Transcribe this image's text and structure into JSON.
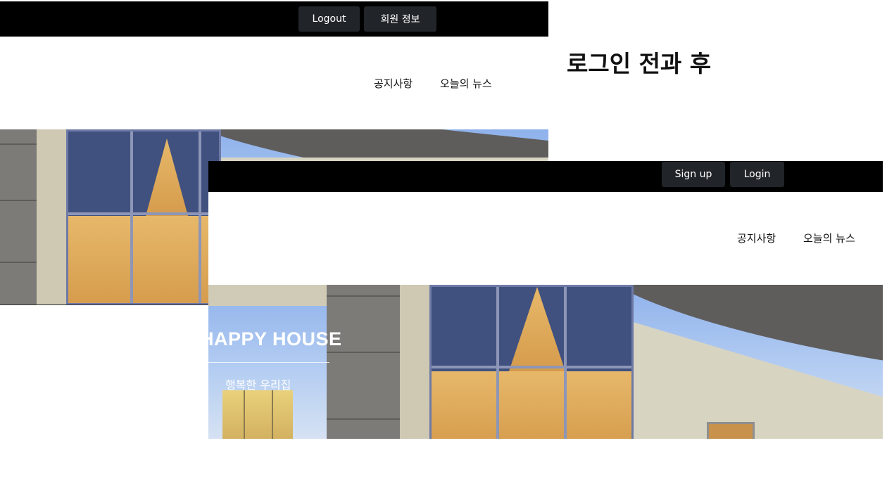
{
  "caption": "로그인 전과 후",
  "after_login": {
    "topbar": {
      "logout_label": "Logout",
      "member_info_label": "회원 정보"
    },
    "nav": {
      "notice_label": "공지사항",
      "news_label": "오늘의 뉴스"
    },
    "hero": {
      "title": "HAPPY HOUSE",
      "subtitle": "행복한 우리집"
    }
  },
  "before_login": {
    "topbar": {
      "signup_label": "Sign up",
      "login_label": "Login"
    },
    "nav": {
      "notice_label": "공지사항",
      "news_label": "오늘의 뉴스"
    }
  },
  "colors": {
    "topbar": "#000000",
    "button": "#212529",
    "button_text": "#ffffff"
  }
}
